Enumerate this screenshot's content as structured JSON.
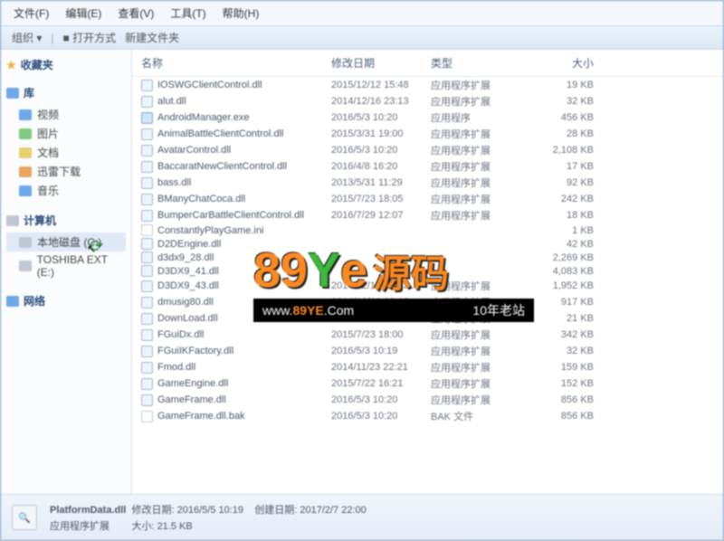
{
  "menu": {
    "file": "文件(F)",
    "edit": "编辑(E)",
    "view": "查看(V)",
    "tools": "工具(T)",
    "help": "帮助(H)"
  },
  "toolbar": {
    "organize": "组织 ▾",
    "open": "■ 打开方式",
    "newfolder": "新建文件夹"
  },
  "sidebar": {
    "fav": {
      "hdr": "收藏夹"
    },
    "libs": {
      "hdr": "库",
      "items": [
        "视频",
        "图片",
        "文档",
        "迅雷下载",
        "音乐"
      ]
    },
    "computer": {
      "hdr": "计算机",
      "items": [
        "本地磁盘 (C:)",
        "TOSHIBA EXT (E:)"
      ]
    },
    "network": {
      "hdr": "网络"
    }
  },
  "columns": {
    "name": "名称",
    "date": "修改日期",
    "type": "类型",
    "size": "大小"
  },
  "files": [
    {
      "n": "IOSWGClientControl.dll",
      "d": "2015/12/12 15:48",
      "t": "应用程序扩展",
      "s": "19 KB"
    },
    {
      "n": "alut.dll",
      "d": "2014/12/16 23:13",
      "t": "应用程序扩展",
      "s": "32 KB"
    },
    {
      "n": "AndroidManager.exe",
      "d": "2016/5/3 10:20",
      "t": "应用程序",
      "s": "456 KB",
      "exe": 1
    },
    {
      "n": "AnimalBattleClientControl.dll",
      "d": "2015/3/31 19:00",
      "t": "应用程序扩展",
      "s": "28 KB"
    },
    {
      "n": "AvatarControl.dll",
      "d": "2016/5/3 10:20",
      "t": "应用程序扩展",
      "s": "2,108 KB"
    },
    {
      "n": "BaccaratNewClientControl.dll",
      "d": "2016/4/8 16:20",
      "t": "应用程序扩展",
      "s": "17 KB"
    },
    {
      "n": "bass.dll",
      "d": "2013/5/31 11:29",
      "t": "应用程序扩展",
      "s": "92 KB"
    },
    {
      "n": "BManyChatCoca.dll",
      "d": "2015/7/23 18:05",
      "t": "应用程序扩展",
      "s": "242 KB"
    },
    {
      "n": "BumperCarBattleClientControl.dll",
      "d": "2016/7/29 12:07",
      "t": "应用程序扩展",
      "s": "18 KB"
    },
    {
      "n": "ConstantlyPlayGame.ini",
      "d": "",
      "t": "",
      "s": "1 KB",
      "txt": 1
    },
    {
      "n": "D2DEngine.dll",
      "d": "",
      "t": "",
      "s": "42 KB"
    },
    {
      "n": "d3dx9_28.dll",
      "d": "",
      "t": "",
      "s": "2,269 KB"
    },
    {
      "n": "D3DX9_41.dll",
      "d": "",
      "t": "",
      "s": "4,083 KB"
    },
    {
      "n": "D3DX9_43.dll",
      "d": "2014/12/16 23:13",
      "t": "应用程序扩展",
      "s": "1,952 KB"
    },
    {
      "n": "dmusig80.dll",
      "d": "2014/12/16 23:13",
      "t": "应用程序扩展",
      "s": "917 KB"
    },
    {
      "n": "DownLoad.dll",
      "d": "2016/5/3 10:19",
      "t": "应用程序扩展",
      "s": "21 KB"
    },
    {
      "n": "FGuiDx.dll",
      "d": "2015/7/23 18:00",
      "t": "应用程序扩展",
      "s": "342 KB"
    },
    {
      "n": "FGuiIKFactory.dll",
      "d": "2016/5/3 10:19",
      "t": "应用程序扩展",
      "s": "32 KB"
    },
    {
      "n": "Fmod.dll",
      "d": "2014/11/23 22:21",
      "t": "应用程序扩展",
      "s": "159 KB"
    },
    {
      "n": "GameEngine.dll",
      "d": "2015/7/22 16:21",
      "t": "应用程序扩展",
      "s": "152 KB"
    },
    {
      "n": "GameFrame.dll",
      "d": "2016/5/3 10:20",
      "t": "应用程序扩展",
      "s": "856 KB"
    },
    {
      "n": "GameFrame.dll.bak",
      "d": "2016/5/3 10:20",
      "t": "BAK 文件",
      "s": "856 KB",
      "txt": 1
    }
  ],
  "status": {
    "name": "PlatformData.dll",
    "line1a": "修改日期: 2016/5/5 10:19",
    "line1b": "创建日期: 2017/2/7 22:00",
    "line2a": "应用程序扩展",
    "line2b": "大小: 21.5 KB"
  },
  "watermark": {
    "p1": "89",
    "p2": "Y",
    "p3": "e",
    "cn": "源码",
    "url_a": "www.",
    "url_b": "89YE",
    "url_c": ".Com",
    "tag": "10年老站"
  }
}
